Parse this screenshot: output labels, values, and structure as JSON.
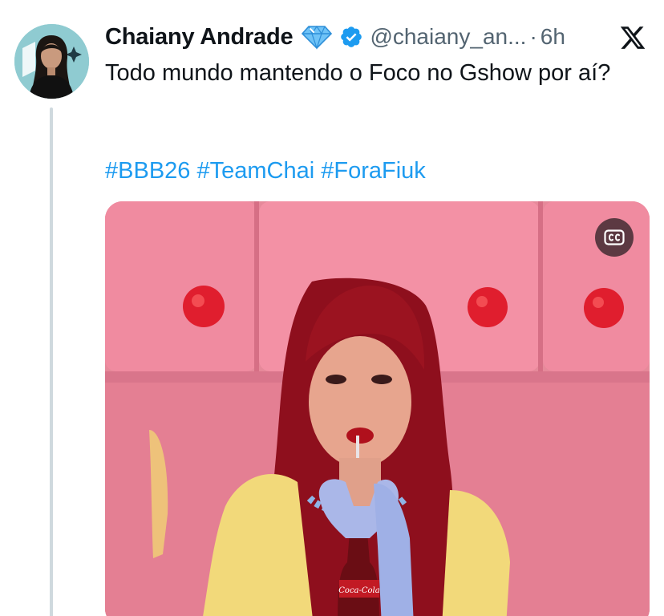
{
  "tweet": {
    "author_name": "Chaiany Andrade",
    "handle": "@chaiany_an...",
    "time_separator": "·",
    "time": "6h",
    "text": "Todo mundo mantendo o Foco no Gshow por aí?",
    "hashtags": [
      "#BBB26",
      "#TeamChai",
      "#ForaFiuk"
    ],
    "media": {
      "bottle_text": "Coca-Cola"
    }
  },
  "icons": {
    "diamond_badge": "diamond-icon",
    "verified_badge": "verified-icon",
    "platform_logo": "x-logo-icon",
    "captions": "closed-captions-icon"
  },
  "colors": {
    "text": "#0f1419",
    "secondary_text": "#536471",
    "link": "#1d9bf0",
    "verified": "#1d9bf0",
    "diamond": "#6fc3f7",
    "media_background": "#e6899a"
  }
}
